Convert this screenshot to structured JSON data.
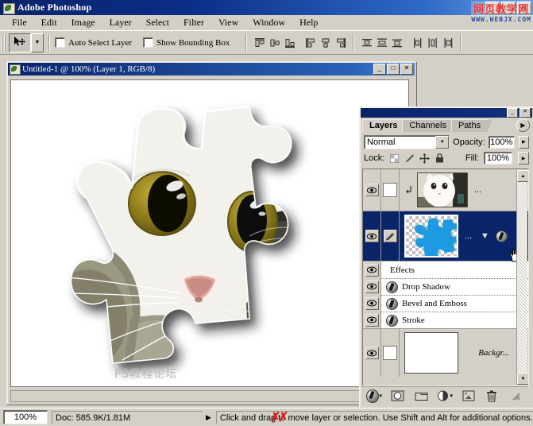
{
  "app": {
    "title": "Adobe Photoshop",
    "window_buttons": [
      "_",
      "□",
      "✕"
    ]
  },
  "menu": {
    "items": [
      "File",
      "Edit",
      "Image",
      "Layer",
      "Select",
      "Filter",
      "View",
      "Window",
      "Help"
    ]
  },
  "options_bar": {
    "tool_icon": "move-tool-icon",
    "preset_arrow": "▼",
    "auto_select_layer": {
      "label": "Auto Select Layer",
      "checked": false
    },
    "show_bounding_box": {
      "label": "Show Bounding Box",
      "checked": false
    },
    "align_icons": [
      "align-top-edges-icon",
      "align-vertical-centers-icon",
      "align-bottom-edges-icon",
      "align-left-edges-icon",
      "align-horizontal-centers-icon",
      "align-right-edges-icon"
    ],
    "distribute_icons": [
      "distribute-top-edges-icon",
      "distribute-vertical-centers-icon",
      "distribute-bottom-edges-icon",
      "distribute-left-edges-icon",
      "distribute-horizontal-centers-icon",
      "distribute-right-edges-icon"
    ]
  },
  "document": {
    "title": "Untitled-1 @ 100% (Layer 1, RGB/8)",
    "buttons": [
      "_",
      "□",
      "✕"
    ],
    "canvas_watermark": "PS教程论坛"
  },
  "layers_palette": {
    "window_buttons": [
      "_",
      "✕"
    ],
    "tabs": [
      {
        "label": "Layers",
        "active": true
      },
      {
        "label": "Channels",
        "active": false
      },
      {
        "label": "Paths",
        "active": false
      }
    ],
    "menu_icon": "palette-menu-icon",
    "blend_mode": "Normal",
    "opacity_label": "Opacity:",
    "opacity_value": "100%",
    "lock_label": "Lock:",
    "lock_icons": [
      "lock-transparency-icon",
      "lock-image-pixels-icon",
      "lock-position-icon",
      "lock-all-icon"
    ],
    "fill_label": "Fill:",
    "fill_value": "100%",
    "layers": [
      {
        "name": "",
        "visible": true,
        "selected": false,
        "thumb": "cat-photo-thumb",
        "clipped": true,
        "name_ellipsis": "..."
      },
      {
        "name": "...",
        "visible": true,
        "selected": true,
        "thumb": "blue-puzzle-piece-thumb",
        "has_effects": true,
        "collapse_icon": "▼",
        "fx_icon": "fx-icon"
      }
    ],
    "effects": {
      "header": "Effects",
      "items": [
        "Drop Shadow",
        "Bevel and Emboss",
        "Stroke"
      ]
    },
    "background_layer": {
      "name": "Backgr...",
      "visible": true,
      "locked": true,
      "lock_icon": "padlock-icon"
    },
    "footer_icons": [
      "layer-style-fx-icon",
      "layer-mask-icon",
      "new-group-icon",
      "new-adjustment-layer-icon",
      "new-layer-icon",
      "delete-layer-icon"
    ]
  },
  "status_bar": {
    "zoom": "100%",
    "doc_info": "Doc: 585.9K/1.81M",
    "expander_icon": "▶",
    "hint": "Click and drag to move layer or selection. Use Shift and Alt for additional options."
  },
  "watermark": {
    "cn": "网页教学网",
    "en": "WWW.WEBJX.COM"
  },
  "colors": {
    "titlebar_blue": "#0a246a",
    "panel_gray": "#d4d0c8",
    "selection_blue": "#0a246a",
    "puzzle_blue": "#1e9be0",
    "watermark_red": "#e8312b"
  }
}
